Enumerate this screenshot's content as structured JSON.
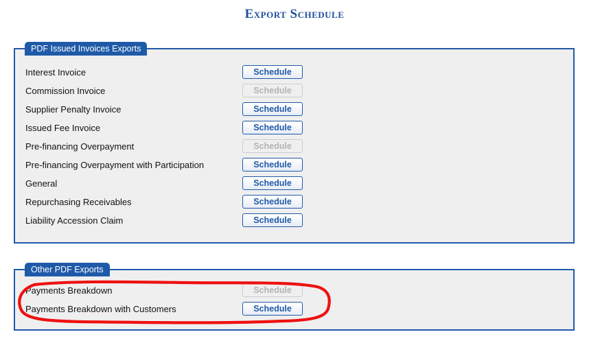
{
  "page": {
    "title": "Export Schedule",
    "background_color": "#ffffff",
    "title_color": "#1f4e9c"
  },
  "theme": {
    "fieldset_border_color": "#1f5aa8",
    "fieldset_background": "#efefef",
    "legend_background": "#1f5aa8",
    "legend_text_color": "#ffffff",
    "button_enabled_color": "#1f5aa8",
    "button_disabled_color": "#b3b3b3",
    "annotation_color": "#ee1111"
  },
  "sections": [
    {
      "legend": "PDF Issued Invoices Exports",
      "rows": [
        {
          "label": "Interest Invoice",
          "button_label": "Schedule",
          "enabled": true
        },
        {
          "label": "Commission Invoice",
          "button_label": "Schedule",
          "enabled": false
        },
        {
          "label": "Supplier Penalty Invoice",
          "button_label": "Schedule",
          "enabled": true
        },
        {
          "label": "Issued Fee Invoice",
          "button_label": "Schedule",
          "enabled": true
        },
        {
          "label": "Pre-financing Overpayment",
          "button_label": "Schedule",
          "enabled": false
        },
        {
          "label": "Pre-financing Overpayment with Participation",
          "button_label": "Schedule",
          "enabled": true
        },
        {
          "label": "General",
          "button_label": "Schedule",
          "enabled": true
        },
        {
          "label": "Repurchasing Receivables",
          "button_label": "Schedule",
          "enabled": true
        },
        {
          "label": "Liability Accession Claim",
          "button_label": "Schedule",
          "enabled": true
        }
      ]
    },
    {
      "legend": "Other PDF Exports",
      "rows": [
        {
          "label": "Payments Breakdown",
          "button_label": "Schedule",
          "enabled": false
        },
        {
          "label": "Payments Breakdown with Customers",
          "button_label": "Schedule",
          "enabled": true
        }
      ]
    }
  ],
  "annotation": {
    "shape": "hand-drawn-ellipse",
    "color": "#ee1111",
    "encircles": "Other PDF Exports rows"
  }
}
